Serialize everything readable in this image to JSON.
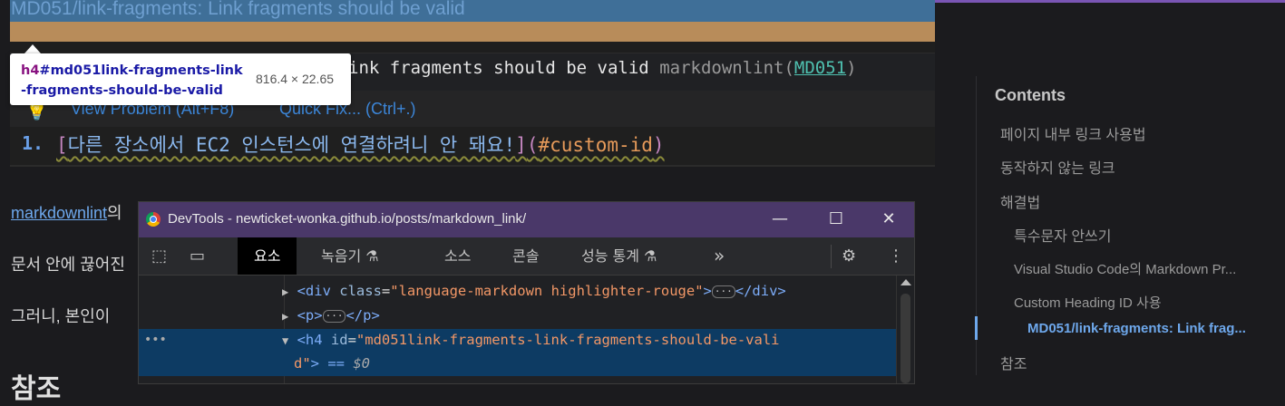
{
  "editor": {
    "heading_title": "MD051/link-fragments: Link fragments should be valid",
    "hover_message": "ink fragments should be valid",
    "hover_source_prefix": "markdownlint(",
    "hover_code": "MD051",
    "hover_source_suffix": ")",
    "view_problem": "View Problem (Alt+F8)",
    "quick_fix": "Quick Fix... (Ctrl+.)",
    "line_number": "1.",
    "line_bracket_open": "[",
    "line_text": "다른 장소에서 EC2 인스턴스에 연결하려니 안 돼요!",
    "line_bracket_close": "]",
    "line_paren_open": "(",
    "line_anchor": "#custom-id",
    "line_paren_close": ")"
  },
  "tooltip": {
    "tag": "h4",
    "id_selector": "#md051link-fragments-link-fragments-should-be-valid",
    "size": "816.4 × 22.65"
  },
  "paragraphs": {
    "p1_link": "markdownlint",
    "p1_rest": "의",
    "p2": "문서 안에 끊어진",
    "p3": "그러니, 본인이 ",
    "heading": "참조"
  },
  "toc": {
    "heading": "Contents",
    "items": [
      {
        "label": "페이지 내부 링크 사용법"
      },
      {
        "label": "동작하지 않는 링크"
      },
      {
        "label": "해결법"
      },
      {
        "label": "특수문자 안쓰기"
      },
      {
        "label": "Visual Studio Code의 Markdown Pr..."
      },
      {
        "label": "Custom Heading ID 사용"
      },
      {
        "label": "MD051/link-fragments: Link frag..."
      },
      {
        "label": "참조"
      }
    ]
  },
  "devtools": {
    "window_title": "DevTools - newticket-wonka.github.io/posts/markdown_link/",
    "tabs": [
      "요소",
      "녹음기 ⚗",
      "소스",
      "콘솔",
      "성능 통계 ⚗",
      "»"
    ],
    "active_tab": "요소",
    "dom": {
      "line1_open": "<div ",
      "line1_attr": "class",
      "line1_val": "\"language-markdown highlighter-rouge\"",
      "line1_close": "</div>",
      "line2_open": "<p>",
      "line2_close": "</p>",
      "line3_open": "<h4 ",
      "line3_attr": "id",
      "line3_val": "\"md051link-fragments-link-fragments-should-be-vali",
      "line4_val": "d\"",
      "line4_rest": "> == ",
      "line4_var": "$0",
      "dots": "•••"
    }
  }
}
